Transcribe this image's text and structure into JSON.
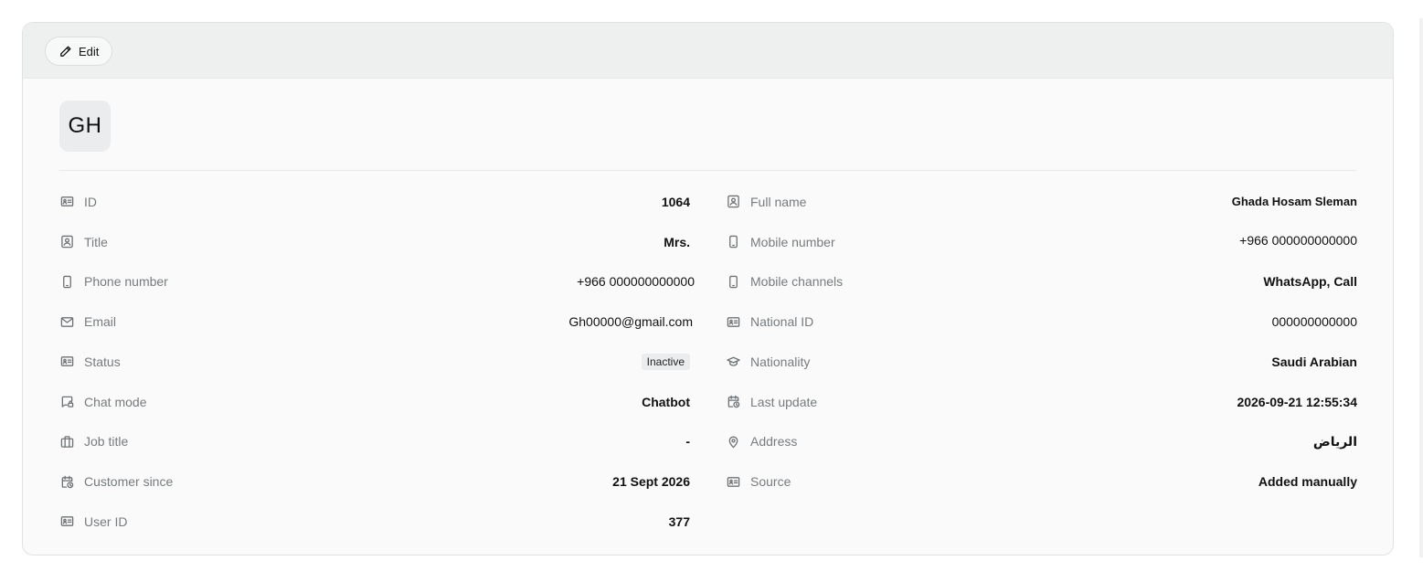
{
  "toolbar": {
    "edit_label": "Edit"
  },
  "avatar": {
    "initials": "GH"
  },
  "left_fields": [
    {
      "icon": "id-card-icon",
      "label": "ID",
      "value": "1064"
    },
    {
      "icon": "user-badge-icon",
      "label": "Title",
      "value": "Mrs."
    },
    {
      "icon": "phone-icon",
      "label": "Phone number",
      "value": "+966 000000000000"
    },
    {
      "icon": "mail-icon",
      "label": "Email",
      "value": "Gh00000@gmail.com"
    },
    {
      "icon": "id-card-icon",
      "label": "Status",
      "value": "Inactive"
    },
    {
      "icon": "chat-mode-icon",
      "label": "Chat mode",
      "value": "Chatbot"
    },
    {
      "icon": "briefcase-icon",
      "label": "Job title",
      "value": "-"
    },
    {
      "icon": "calendar-clock-icon",
      "label": "Customer since",
      "value": "21 Sept 2026"
    },
    {
      "icon": "id-card-icon",
      "label": "User ID",
      "value": "377"
    }
  ],
  "right_fields": [
    {
      "icon": "user-badge-icon",
      "label": "Full name",
      "value": "Ghada Hosam Sleman"
    },
    {
      "icon": "phone-icon",
      "label": "Mobile number",
      "value": "+966 000000000000"
    },
    {
      "icon": "phone-icon",
      "label": "Mobile channels",
      "value": "WhatsApp, Call"
    },
    {
      "icon": "id-card-icon",
      "label": "National ID",
      "value": "000000000000"
    },
    {
      "icon": "graduation-cap-icon",
      "label": "Nationality",
      "value": "Saudi Arabian"
    },
    {
      "icon": "calendar-clock-icon",
      "label": "Last update",
      "value": "2026-09-21 12:55:34"
    },
    {
      "icon": "map-pin-icon",
      "label": "Address",
      "value": "الرياض"
    },
    {
      "icon": "id-card-icon",
      "label": "Source",
      "value": "Added manually"
    }
  ]
}
